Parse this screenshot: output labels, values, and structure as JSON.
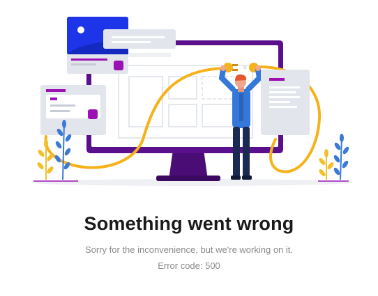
{
  "error": {
    "title": "Something went wrong",
    "message": "Sorry for the inconvenience, but we're working on it.",
    "code_text": "Error code: 500"
  },
  "illustration": {
    "scene": "person-holding-unplugged-cable-in-front-of-monitor",
    "colors": {
      "monitor_frame": "#5a0f8c",
      "cable": "#f5b21a",
      "card_accent": "#9b11b3",
      "card_blue": "#1d34e8",
      "shirt": "#3478d9",
      "pants": "#1b2a52",
      "plant_blue": "#3a79d6",
      "plant_yellow": "#f2bf2b"
    }
  }
}
